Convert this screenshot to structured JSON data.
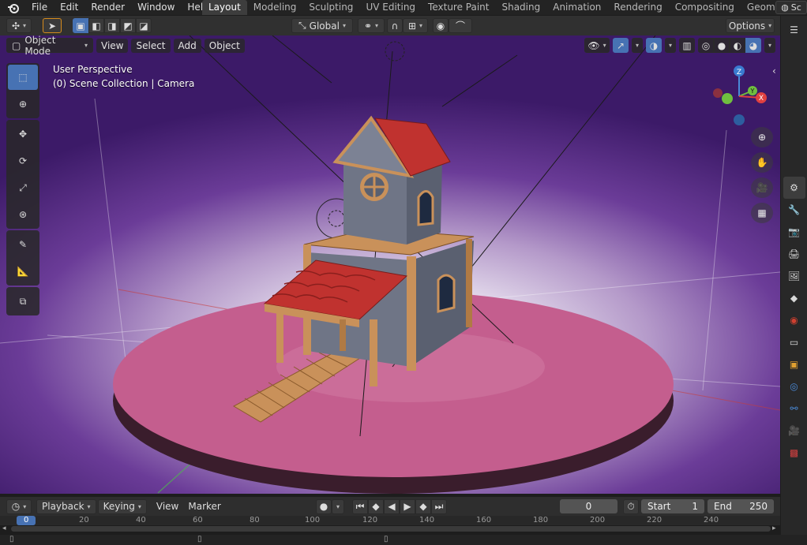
{
  "menu": {
    "items": [
      "File",
      "Edit",
      "Render",
      "Window",
      "Help"
    ]
  },
  "workspaces": {
    "tabs": [
      "Layout",
      "Modeling",
      "Sculpting",
      "UV Editing",
      "Texture Paint",
      "Shading",
      "Animation",
      "Rendering",
      "Compositing",
      "Geometry Nod"
    ],
    "active": "Layout"
  },
  "top_right": {
    "scene_label": "Sc"
  },
  "viewport_header": {
    "transform_orientation": "Global",
    "options_label": "Options"
  },
  "viewport_sub_header": {
    "mode": "Object Mode",
    "menus": [
      "View",
      "Select",
      "Add",
      "Object"
    ]
  },
  "viewport_info": {
    "line1": "User Perspective",
    "line2": "(0) Scene Collection | Camera"
  },
  "gizmo": {
    "z_label": "Z",
    "y_label": "Y",
    "x_label": "X"
  },
  "timeline": {
    "playback_label": "Playback",
    "keying_label": "Keying",
    "view_label": "View",
    "marker_label": "Marker",
    "current_frame": "0",
    "start_label": "Start",
    "start_value": "1",
    "end_label": "End",
    "end_value": "250",
    "ruler_marks": [
      "0",
      "20",
      "40",
      "60",
      "80",
      "100",
      "120",
      "140",
      "160",
      "180",
      "200",
      "220",
      "240"
    ]
  },
  "colors": {
    "accent": "#4772b3",
    "background_purple": "#4a2478",
    "platform_pink": "#c45e8e",
    "roof_red": "#c0322f",
    "wood": "#c9915a",
    "wall": "#6f7586"
  }
}
